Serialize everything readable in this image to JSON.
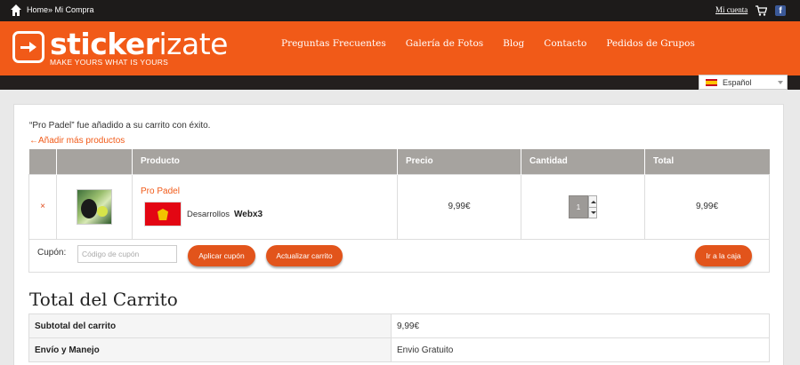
{
  "topbar": {
    "breadcrumb_home": "Home",
    "breadcrumb_sep": "»",
    "breadcrumb_current": " Mi Compra",
    "account": "Mi cuenta",
    "facebook": "f"
  },
  "brand": {
    "name_bold": "sticker",
    "name_light": "izate",
    "tagline": "MAKE YOURS WHAT IS YOURS",
    "accent": "#f15a18"
  },
  "nav": {
    "items": [
      "Preguntas Frecuentes",
      "Galería de Fotos",
      "Blog",
      "Contacto",
      "Pedidos de Grupos"
    ]
  },
  "language": {
    "selected": "Español"
  },
  "notice": {
    "message": "“Pro Padel” fue añadido a su carrito con éxito.",
    "back_link": "←Añadir más productos"
  },
  "cart": {
    "headers": [
      "",
      "",
      "Producto",
      "Precio",
      "Cantidad",
      "Total"
    ],
    "items": [
      {
        "remove": "×",
        "name": "Pro Padel",
        "option_label": "Desarrollos",
        "option_value": "Webx3",
        "price": "9,99€",
        "quantity": "1",
        "total": "9,99€"
      }
    ]
  },
  "coupon": {
    "label": "Cupón:",
    "placeholder": "Código de cupón",
    "apply": "Aplicar cupón",
    "update": "Actualizar carrito",
    "checkout": "Ir a la caja"
  },
  "totals": {
    "title": "Total del Carrito",
    "rows": [
      {
        "label": "Subtotal del carrito",
        "value": "9,99€"
      },
      {
        "label": "Envío y Manejo",
        "value": "Envio Gratuito"
      }
    ]
  }
}
